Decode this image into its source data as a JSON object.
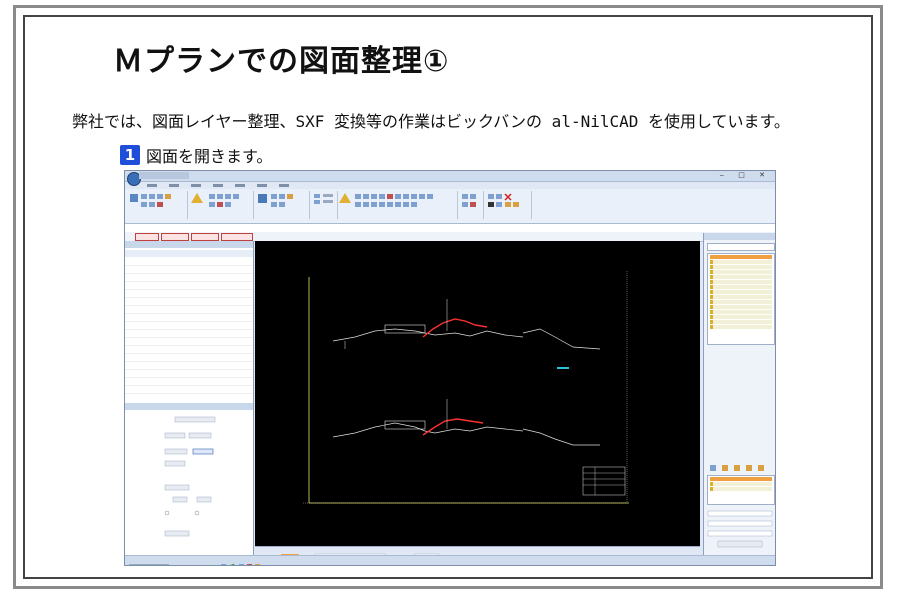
{
  "page": {
    "title": "Ｍプランでの図面整理①",
    "intro": "弊社では、図面レイヤー整理、SXF 変換等の作業はビックバンの al-NilCAD を使用しています。",
    "step": {
      "number": "1",
      "text": "図面を開きます。"
    }
  }
}
